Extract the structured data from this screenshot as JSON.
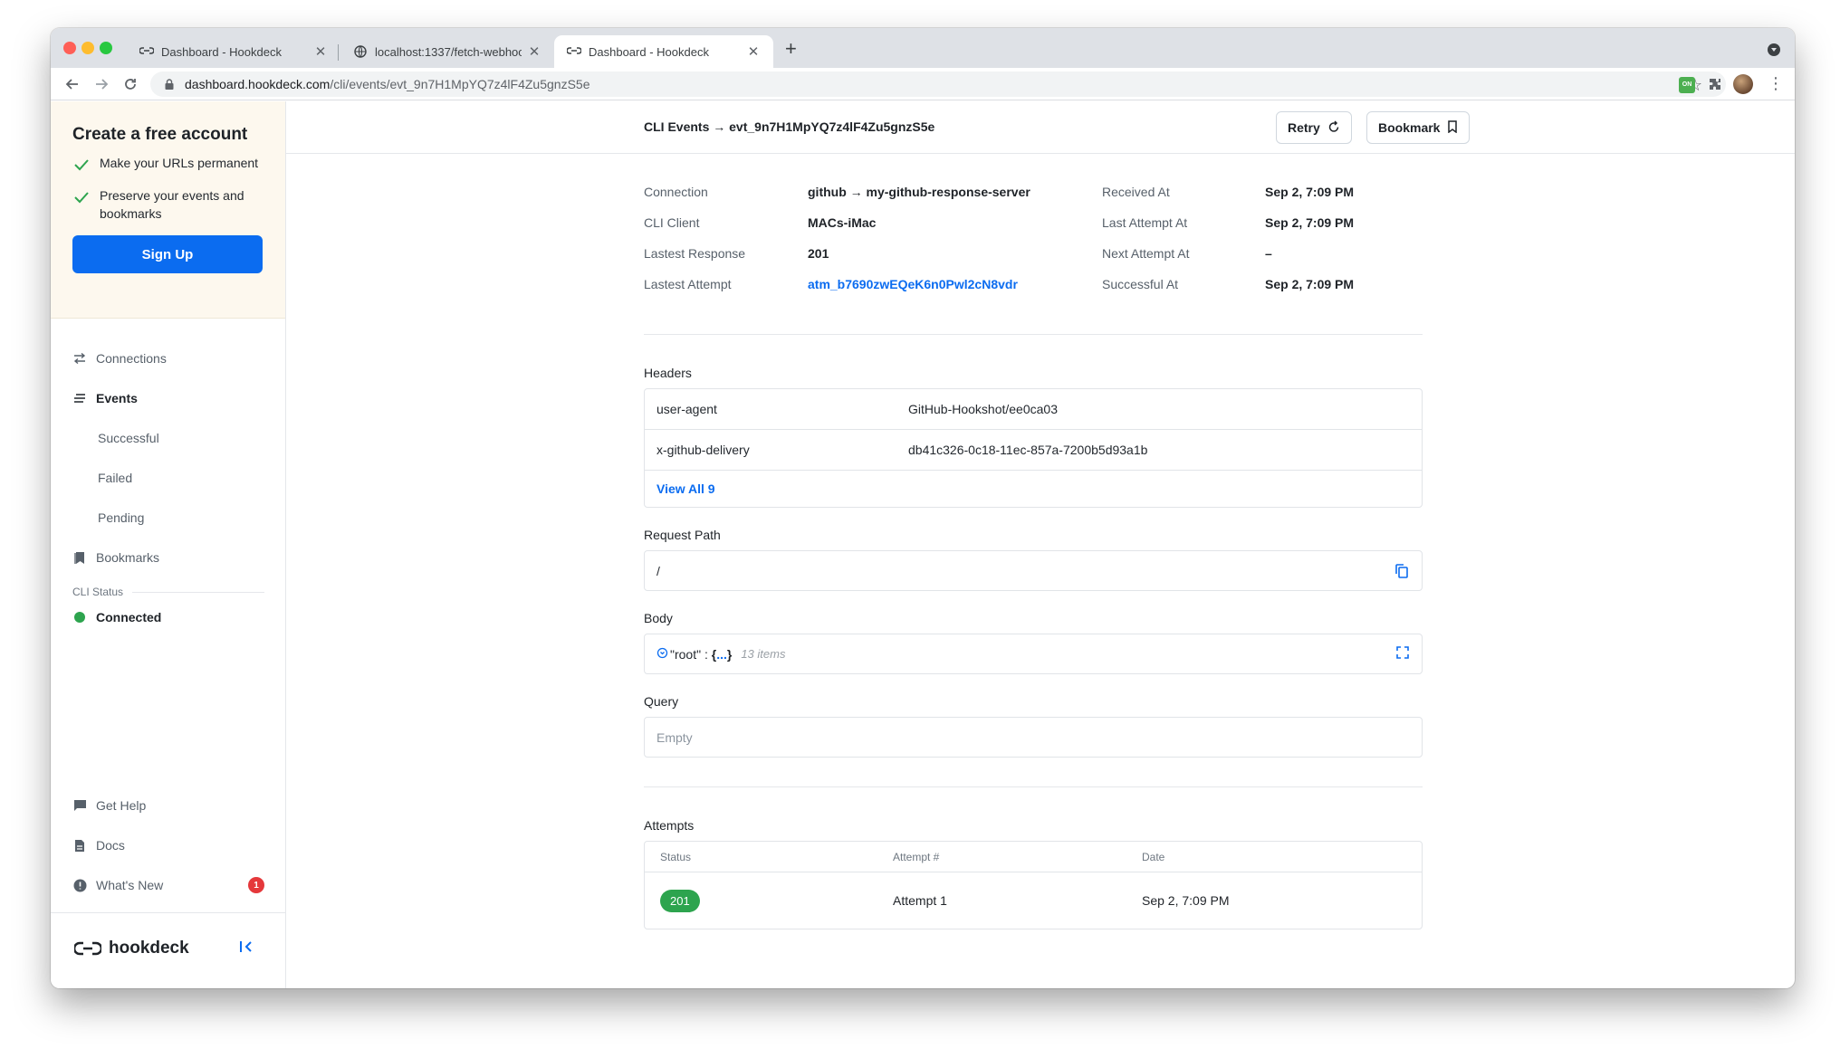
{
  "browser": {
    "tabs": [
      {
        "title": "Dashboard - Hookdeck",
        "icon": "hookdeck-icon",
        "active": false
      },
      {
        "title": "localhost:1337/fetch-webhook",
        "icon": "globe-icon",
        "active": false
      },
      {
        "title": "Dashboard - Hookdeck",
        "icon": "hookdeck-icon",
        "active": true
      }
    ],
    "new_tab_label": "+",
    "url_host": "dashboard.hookdeck.com",
    "url_path": "/cli/events/evt_9n7H1MpYQ7z4lF4Zu5gnzS5e"
  },
  "sidebar": {
    "promo": {
      "title": "Create a free account",
      "items": [
        "Make your URLs permanent",
        "Preserve your events and bookmarks"
      ],
      "signup_label": "Sign Up"
    },
    "nav": {
      "connections": "Connections",
      "events": "Events",
      "successful": "Successful",
      "failed": "Failed",
      "pending": "Pending",
      "bookmarks": "Bookmarks"
    },
    "cli_status_label": "CLI Status",
    "cli_status_value": "Connected",
    "bottom": {
      "get_help": "Get Help",
      "docs": "Docs",
      "whats_new": "What's New",
      "whats_new_badge": "1"
    },
    "brand": "hookdeck"
  },
  "header": {
    "breadcrumb": "CLI Events → evt_9n7H1MpYQ7z4lF4Zu5gnzS5e",
    "retry_label": "Retry",
    "bookmark_label": "Bookmark"
  },
  "details": {
    "connection_label": "Connection",
    "connection_value": "github → my-github-response-server",
    "cli_client_label": "CLI Client",
    "cli_client_value": "MACs-iMac",
    "latest_response_label": "Lastest Response",
    "latest_response_value": "201",
    "latest_attempt_label": "Lastest Attempt",
    "latest_attempt_value": "atm_b7690zwEQeK6n0Pwl2cN8vdr",
    "received_at_label": "Received At",
    "received_at_value": "Sep 2, 7:09 PM",
    "last_attempt_at_label": "Last Attempt At",
    "last_attempt_at_value": "Sep 2, 7:09 PM",
    "next_attempt_at_label": "Next Attempt At",
    "next_attempt_at_value": "–",
    "successful_at_label": "Successful At",
    "successful_at_value": "Sep 2, 7:09 PM"
  },
  "headers_section": {
    "title": "Headers",
    "rows": [
      {
        "key": "user-agent",
        "value": "GitHub-Hookshot/ee0ca03"
      },
      {
        "key": "x-github-delivery",
        "value": "db41c326-0c18-11ec-857a-7200b5d93a1b"
      }
    ],
    "view_all_label": "View All 9"
  },
  "request_path": {
    "title": "Request Path",
    "value": "/"
  },
  "body": {
    "title": "Body",
    "key": "\"root\" :",
    "brace_open": "{",
    "ellipsis": "...",
    "brace_close": "}",
    "count": "13 items"
  },
  "query": {
    "title": "Query",
    "value": "Empty"
  },
  "attempts": {
    "title": "Attempts",
    "columns": [
      "Status",
      "Attempt #",
      "Date"
    ],
    "rows": [
      {
        "status": "201",
        "attempt": "Attempt 1",
        "date": "Sep 2, 7:09 PM"
      }
    ]
  },
  "colors": {
    "accent": "#0b6cf0",
    "success": "#2da44e",
    "promo_bg": "#fdf8ee",
    "badge": "#e5383b"
  }
}
